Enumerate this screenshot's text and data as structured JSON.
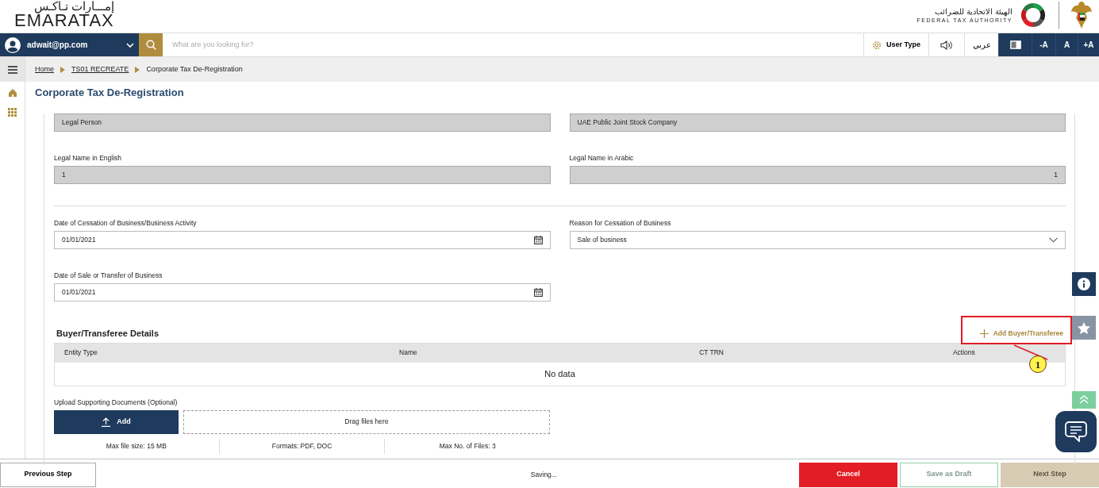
{
  "header": {
    "logo_arabic": "إمـــارات تـاكـس",
    "logo": "EMARATAX",
    "authority_arabic": "الهيئة الاتحادية للضرائب",
    "authority": "FEDERAL TAX AUTHORITY"
  },
  "topbar": {
    "user": "adwait@pp.com",
    "search_placeholder": "What are you looking for?",
    "user_type": "User Type",
    "language": "عربي",
    "font_buttons": [
      "-A",
      "A",
      "+A"
    ]
  },
  "breadcrumb": [
    {
      "label": "Home",
      "link": true
    },
    {
      "label": "TS01 RECREATE",
      "link": true
    },
    {
      "label": "Corporate Tax De-Registration",
      "link": false
    }
  ],
  "page_title": "Corporate Tax De-Registration",
  "form_sections": [
    {
      "rows": [
        [
          {
            "kind": "readonly",
            "value": "Legal Person"
          },
          {
            "kind": "readonly",
            "value": "UAE Public Joint Stock Company"
          }
        ],
        [
          {
            "kind": "readonly",
            "label": "Legal Name in English",
            "value": "1"
          },
          {
            "kind": "readonly_rtl",
            "label": "Legal Name in Arabic",
            "value": "1"
          }
        ]
      ]
    },
    {
      "rows": [
        [
          {
            "kind": "date",
            "label": "Date of Cessation of Business/Business Activity",
            "value": "01/01/2021"
          },
          {
            "kind": "select",
            "label": "Reason for Cessation of Business",
            "value": "Sale of business"
          }
        ],
        [
          {
            "kind": "date",
            "label": "Date of Sale or Transfer of Business",
            "value": "01/01/2021"
          }
        ]
      ]
    }
  ],
  "buyer": {
    "title": "Buyer/Transferee Details",
    "add_label": "Add Buyer/Transferee",
    "columns": [
      "Entity Type",
      "Name",
      "CT TRN",
      "Actions"
    ],
    "empty_text": "No data"
  },
  "annotation": {
    "number": "1"
  },
  "upload": {
    "label": "Upload Supporting Documents (Optional)",
    "button": "Add",
    "drop_text": "Drag files here",
    "info": [
      "Max file size: 15 MB",
      "Formats: PDF, DOC",
      "Max No. of Files: 3"
    ]
  },
  "footer": {
    "previous": "Previous Step",
    "status": "Saving...",
    "buttons": [
      {
        "label": "Cancel",
        "kind": "danger",
        "disabled": false
      },
      {
        "label": "Save as Draft",
        "kind": "outline",
        "disabled": true
      },
      {
        "label": "Next Step",
        "kind": "primary",
        "disabled": true
      }
    ]
  }
}
